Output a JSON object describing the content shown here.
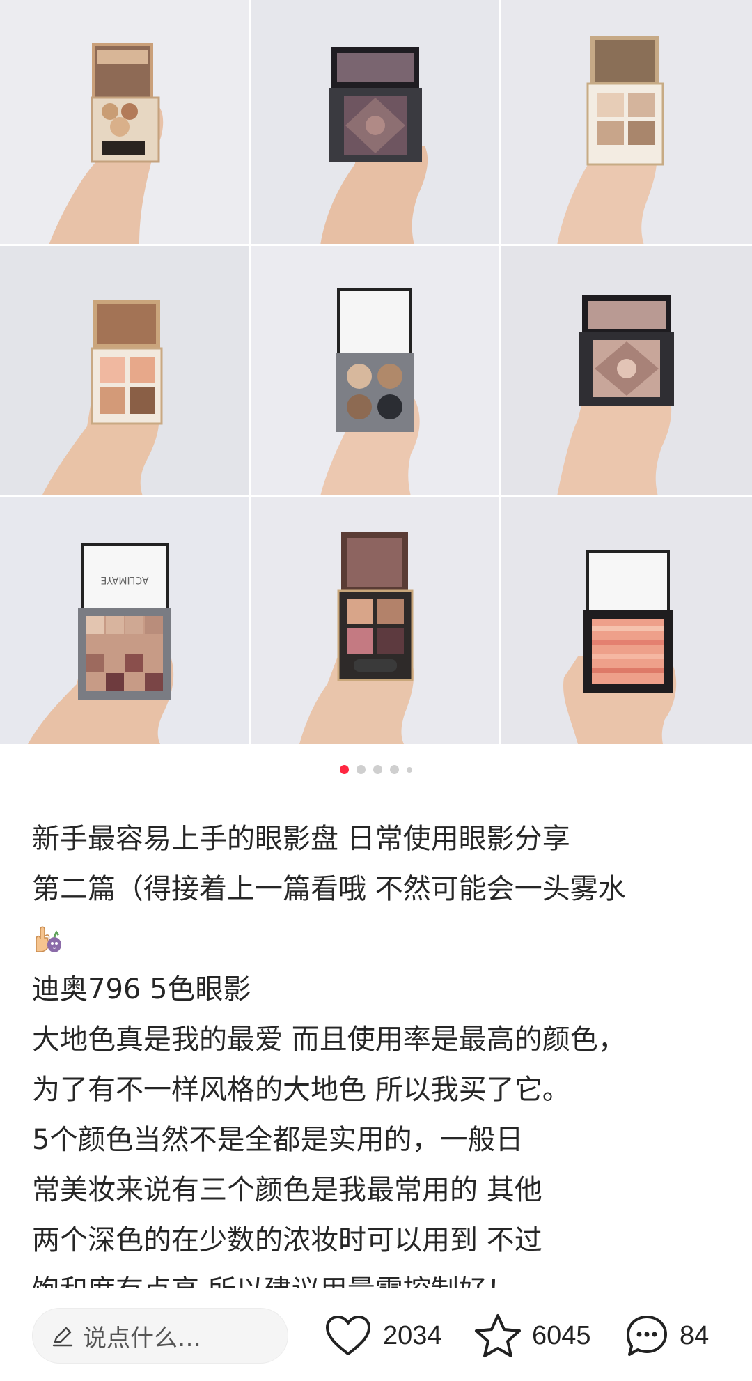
{
  "gallery": {
    "image_count": 5,
    "active_index": 0,
    "photos": [
      {
        "icon": "palette-photo-icon"
      },
      {
        "icon": "palette-photo-icon"
      },
      {
        "icon": "palette-photo-icon"
      },
      {
        "icon": "palette-photo-icon"
      },
      {
        "icon": "palette-photo-icon"
      },
      {
        "icon": "palette-photo-icon"
      },
      {
        "icon": "palette-photo-icon",
        "brand_print": "ACLIMAYE"
      },
      {
        "icon": "palette-photo-icon"
      },
      {
        "icon": "palette-photo-icon"
      }
    ]
  },
  "post": {
    "lines": [
      "新手最容易上手的眼影盘 日常使用眼影分享",
      "第二篇（得接着上一篇看哦 不然可能会一头雾水",
      "",
      "迪奥796 5色眼影",
      "大地色真是我的最爱 而且使用率是最高的颜色，",
      "为了有不一样风格的大地色 所以我买了它。",
      "5个颜色当然不是全都是实用的，一般日",
      "常美妆来说有三个颜色是我最常用的 其他",
      "两个深色的在少数的浓妆时可以用到 不过",
      "饱和度有点高 所以建议用量需控制好！"
    ]
  },
  "bottom_bar": {
    "comment_placeholder": "说点什么…",
    "likes": "2034",
    "collects": "6045",
    "comments": "84"
  },
  "colors": {
    "accent": "#ff2741",
    "dot_inactive": "#cfcfcf",
    "text": "#262626"
  }
}
